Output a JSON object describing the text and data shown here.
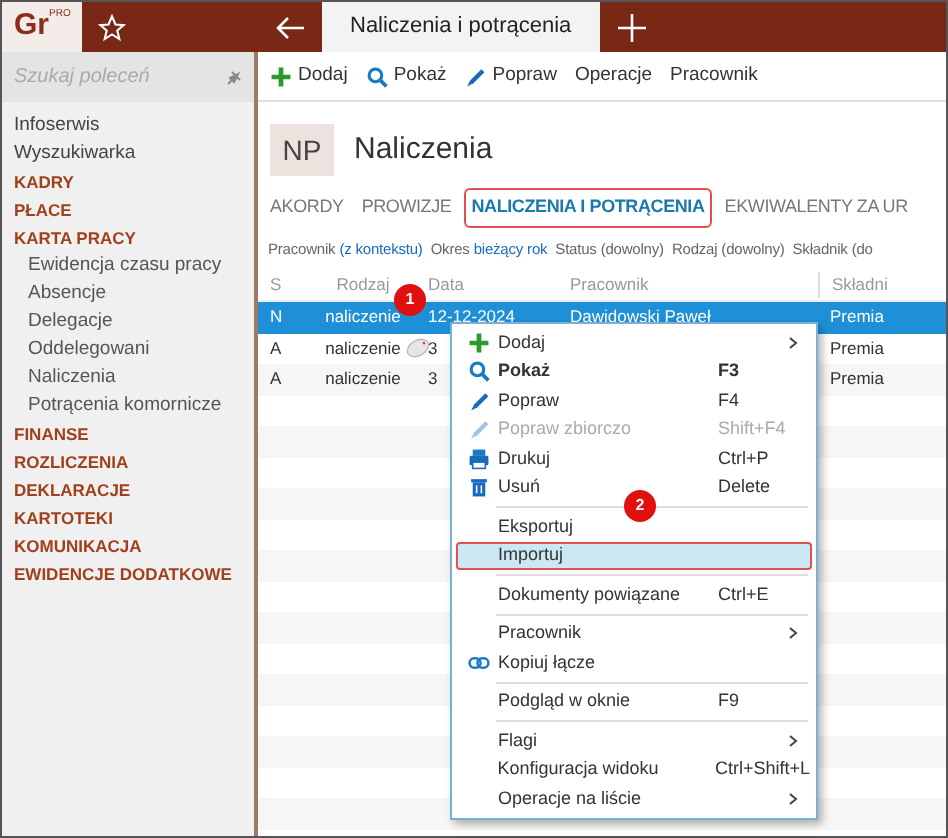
{
  "app": {
    "logo": "Gr",
    "logo_sup": "PRO"
  },
  "tabs": [
    {
      "label": "Naliczenia i potrącenia",
      "selected": true
    }
  ],
  "sidebar": {
    "search_placeholder": "Szukaj poleceń",
    "items": [
      {
        "label": "Infoserwis",
        "kind": "link"
      },
      {
        "label": "Wyszukiwarka",
        "kind": "link"
      },
      {
        "label": "KADRY",
        "kind": "section"
      },
      {
        "label": "PŁACE",
        "kind": "section"
      },
      {
        "label": "KARTA PRACY",
        "kind": "section",
        "children": [
          {
            "label": "Ewidencja czasu pracy"
          },
          {
            "label": "Absencje"
          },
          {
            "label": "Delegacje"
          },
          {
            "label": "Oddelegowani"
          },
          {
            "label": "Naliczenia"
          },
          {
            "label": "Potrącenia komornicze"
          }
        ]
      },
      {
        "label": "FINANSE",
        "kind": "section"
      },
      {
        "label": "ROZLICZENIA",
        "kind": "section"
      },
      {
        "label": "DEKLARACJE",
        "kind": "section"
      },
      {
        "label": "KARTOTEKI",
        "kind": "section"
      },
      {
        "label": "KOMUNIKACJA",
        "kind": "section"
      },
      {
        "label": "EWIDENCJE DODATKOWE",
        "kind": "section"
      }
    ]
  },
  "toolbar": [
    {
      "label": "Dodaj"
    },
    {
      "label": "Pokaż"
    },
    {
      "label": "Popraw"
    },
    {
      "label": "Operacje"
    },
    {
      "label": "Pracownik"
    }
  ],
  "page": {
    "badge": "NP",
    "title": "Naliczenia"
  },
  "view_tabs": [
    {
      "label": "AKORDY",
      "selected": false
    },
    {
      "label": "PROWIZJE",
      "selected": false
    },
    {
      "label": "NALICZENIA I POTRĄCENIA",
      "selected": true
    },
    {
      "label": "EKWIWALENTY ZA UR",
      "selected": false
    }
  ],
  "filters": [
    {
      "label": "Pracownik",
      "value": "(z kontekstu)"
    },
    {
      "label": "Okres",
      "value": "bieżący rok"
    },
    {
      "label": "Status (dowolny)"
    },
    {
      "label": "Rodzaj (dowolny)"
    },
    {
      "label": "Składnik (do"
    }
  ],
  "table": {
    "columns": [
      "S",
      "Rodzaj",
      "Data",
      "Pracownik",
      "Składni"
    ],
    "rows": [
      {
        "cells": [
          "N",
          "naliczenie",
          "12-12-2024",
          "Dawidowski Paweł",
          "Premia"
        ],
        "selected": true
      },
      {
        "cells": [
          "A",
          "naliczenie",
          "3",
          "",
          "Premia"
        ],
        "selected": false
      },
      {
        "cells": [
          "A",
          "naliczenie",
          "3",
          "",
          "Premia"
        ],
        "selected": false
      }
    ]
  },
  "context_menu": [
    {
      "kind": "item",
      "label": "Dodaj",
      "submenu": true,
      "disabled": false,
      "bold": false,
      "selected": false
    },
    {
      "kind": "item",
      "label": "Pokaż",
      "shortcut": "F3",
      "submenu": false,
      "disabled": false,
      "bold": true,
      "selected": false
    },
    {
      "kind": "item",
      "label": "Popraw",
      "shortcut": "F4",
      "submenu": false,
      "disabled": false,
      "bold": false,
      "selected": false
    },
    {
      "kind": "item",
      "label": "Popraw zbiorczo",
      "shortcut": "Shift+F4",
      "submenu": false,
      "disabled": true,
      "bold": false,
      "selected": false
    },
    {
      "kind": "item",
      "label": "Drukuj",
      "shortcut": "Ctrl+P",
      "submenu": false,
      "disabled": false,
      "bold": false,
      "selected": false
    },
    {
      "kind": "item",
      "label": "Usuń",
      "shortcut": "Delete",
      "submenu": false,
      "disabled": false,
      "bold": false,
      "selected": false
    },
    {
      "kind": "separator"
    },
    {
      "kind": "item",
      "label": "Eksportuj",
      "submenu": false,
      "disabled": false,
      "bold": false,
      "selected": false
    },
    {
      "kind": "item",
      "label": "Importuj",
      "submenu": false,
      "disabled": false,
      "bold": false,
      "selected": true
    },
    {
      "kind": "separator"
    },
    {
      "kind": "item",
      "label": "Dokumenty powiązane",
      "shortcut": "Ctrl+E",
      "submenu": false,
      "disabled": false,
      "bold": false,
      "selected": false
    },
    {
      "kind": "separator"
    },
    {
      "kind": "item",
      "label": "Pracownik",
      "submenu": true,
      "disabled": false,
      "bold": false,
      "selected": false
    },
    {
      "kind": "item",
      "label": "Kopiuj łącze",
      "submenu": false,
      "disabled": false,
      "bold": false,
      "selected": false
    },
    {
      "kind": "separator"
    },
    {
      "kind": "item",
      "label": "Podgląd w oknie",
      "shortcut": "F9",
      "submenu": false,
      "disabled": false,
      "bold": false,
      "selected": false
    },
    {
      "kind": "separator"
    },
    {
      "kind": "item",
      "label": "Flagi",
      "submenu": true,
      "disabled": false,
      "bold": false,
      "selected": false
    },
    {
      "kind": "item",
      "label": "Konfiguracja widoku",
      "shortcut": "Ctrl+Shift+L",
      "submenu": false,
      "disabled": false,
      "bold": false,
      "selected": false
    },
    {
      "kind": "item",
      "label": "Operacje na liście",
      "submenu": true,
      "disabled": false,
      "bold": false,
      "selected": false
    }
  ],
  "step_markers": [
    "1",
    "2"
  ]
}
